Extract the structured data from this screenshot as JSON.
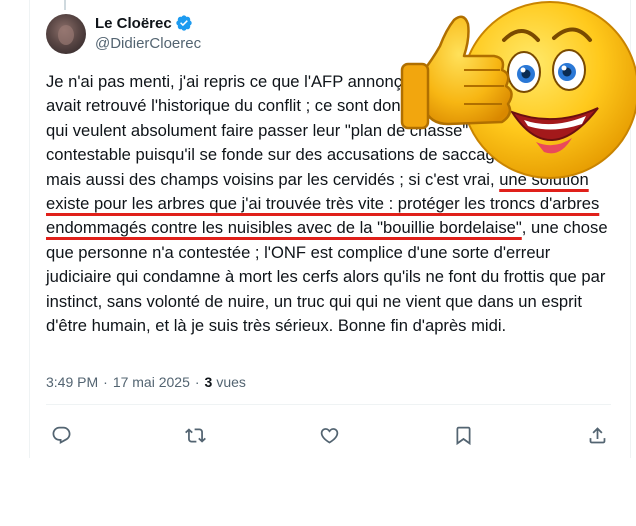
{
  "author": {
    "display_name": "Le Cloërec",
    "handle": "@DidierCloerec",
    "verified": true
  },
  "tweet": {
    "text_before": "Je n'ai pas menti, j'ai repris ce que l'AFP annonçait, et aussi la presse qui avait retrouvé l'historique du conflit ; ce sont donc les chasseurs du patelin qui veulent absolument faire passer leur \"plan de chasse\" qui devrait être contestable puisqu'il se fonde sur des accusations de saccage de la forêt mais aussi des champs voisins par les cervidés ; si c'est vrai, ",
    "text_highlight": "une solution existe pour les arbres que j'ai trouvée très vite : protéger les troncs d'arbres endommagés contre les nuisibles avec de la \"bouillie bordelaise\"",
    "text_after": ", une chose que personne n'a contestée ; l'ONF est complice d'une sorte d'erreur judiciaire qui condamne à mort les cerfs alors qu'ils ne font du frottis que par instinct, sans volonté de nuire, un truc qui qui ne vient que dans un esprit d'être humain, et là je suis très sérieux. Bonne fin d'après midi."
  },
  "meta": {
    "time": "3:49 PM",
    "separator": "·",
    "date": "17 mai 2025",
    "views_count": "3",
    "views_label": "vues"
  },
  "actions": {
    "reply_icon": "reply-icon",
    "retweet_icon": "retweet-icon",
    "like_icon": "like-icon",
    "bookmark_icon": "bookmark-icon",
    "share_icon": "share-icon"
  },
  "overlay": {
    "icon": "thumbs-up-emoji-icon"
  },
  "colors": {
    "accent": "#1d9bf0",
    "highlight_underline": "#e0201a",
    "secondary_text": "#536471",
    "icon_gray": "#536471"
  }
}
